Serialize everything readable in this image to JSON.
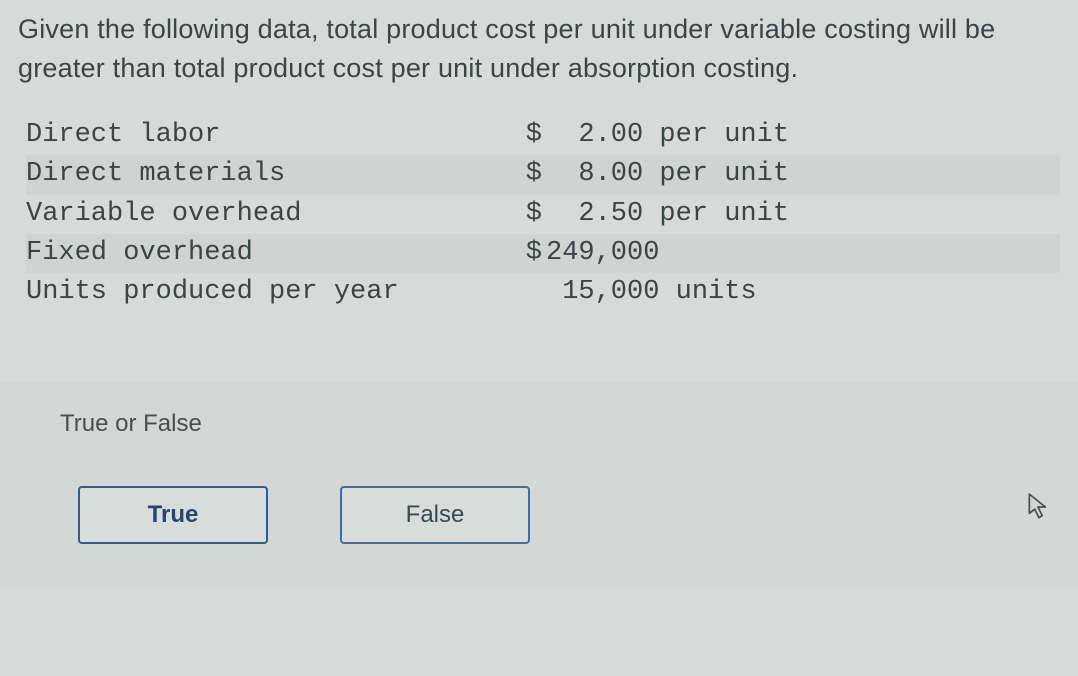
{
  "question": "Given the following data, total product cost per unit under variable costing will be greater than total product cost per unit under absorption costing.",
  "rows": [
    {
      "label": "Direct labor",
      "currency": "$",
      "value": "  2.00 per unit"
    },
    {
      "label": "Direct materials",
      "currency": "$",
      "value": "  8.00 per unit"
    },
    {
      "label": "Variable overhead",
      "currency": "$",
      "value": "  2.50 per unit"
    },
    {
      "label": "Fixed overhead",
      "currency": "$",
      "value": "249,000"
    },
    {
      "label": "Units produced per year",
      "currency": "",
      "value": " 15,000 units"
    }
  ],
  "prompt": "True or False",
  "buttons": {
    "true": "True",
    "false": "False"
  }
}
